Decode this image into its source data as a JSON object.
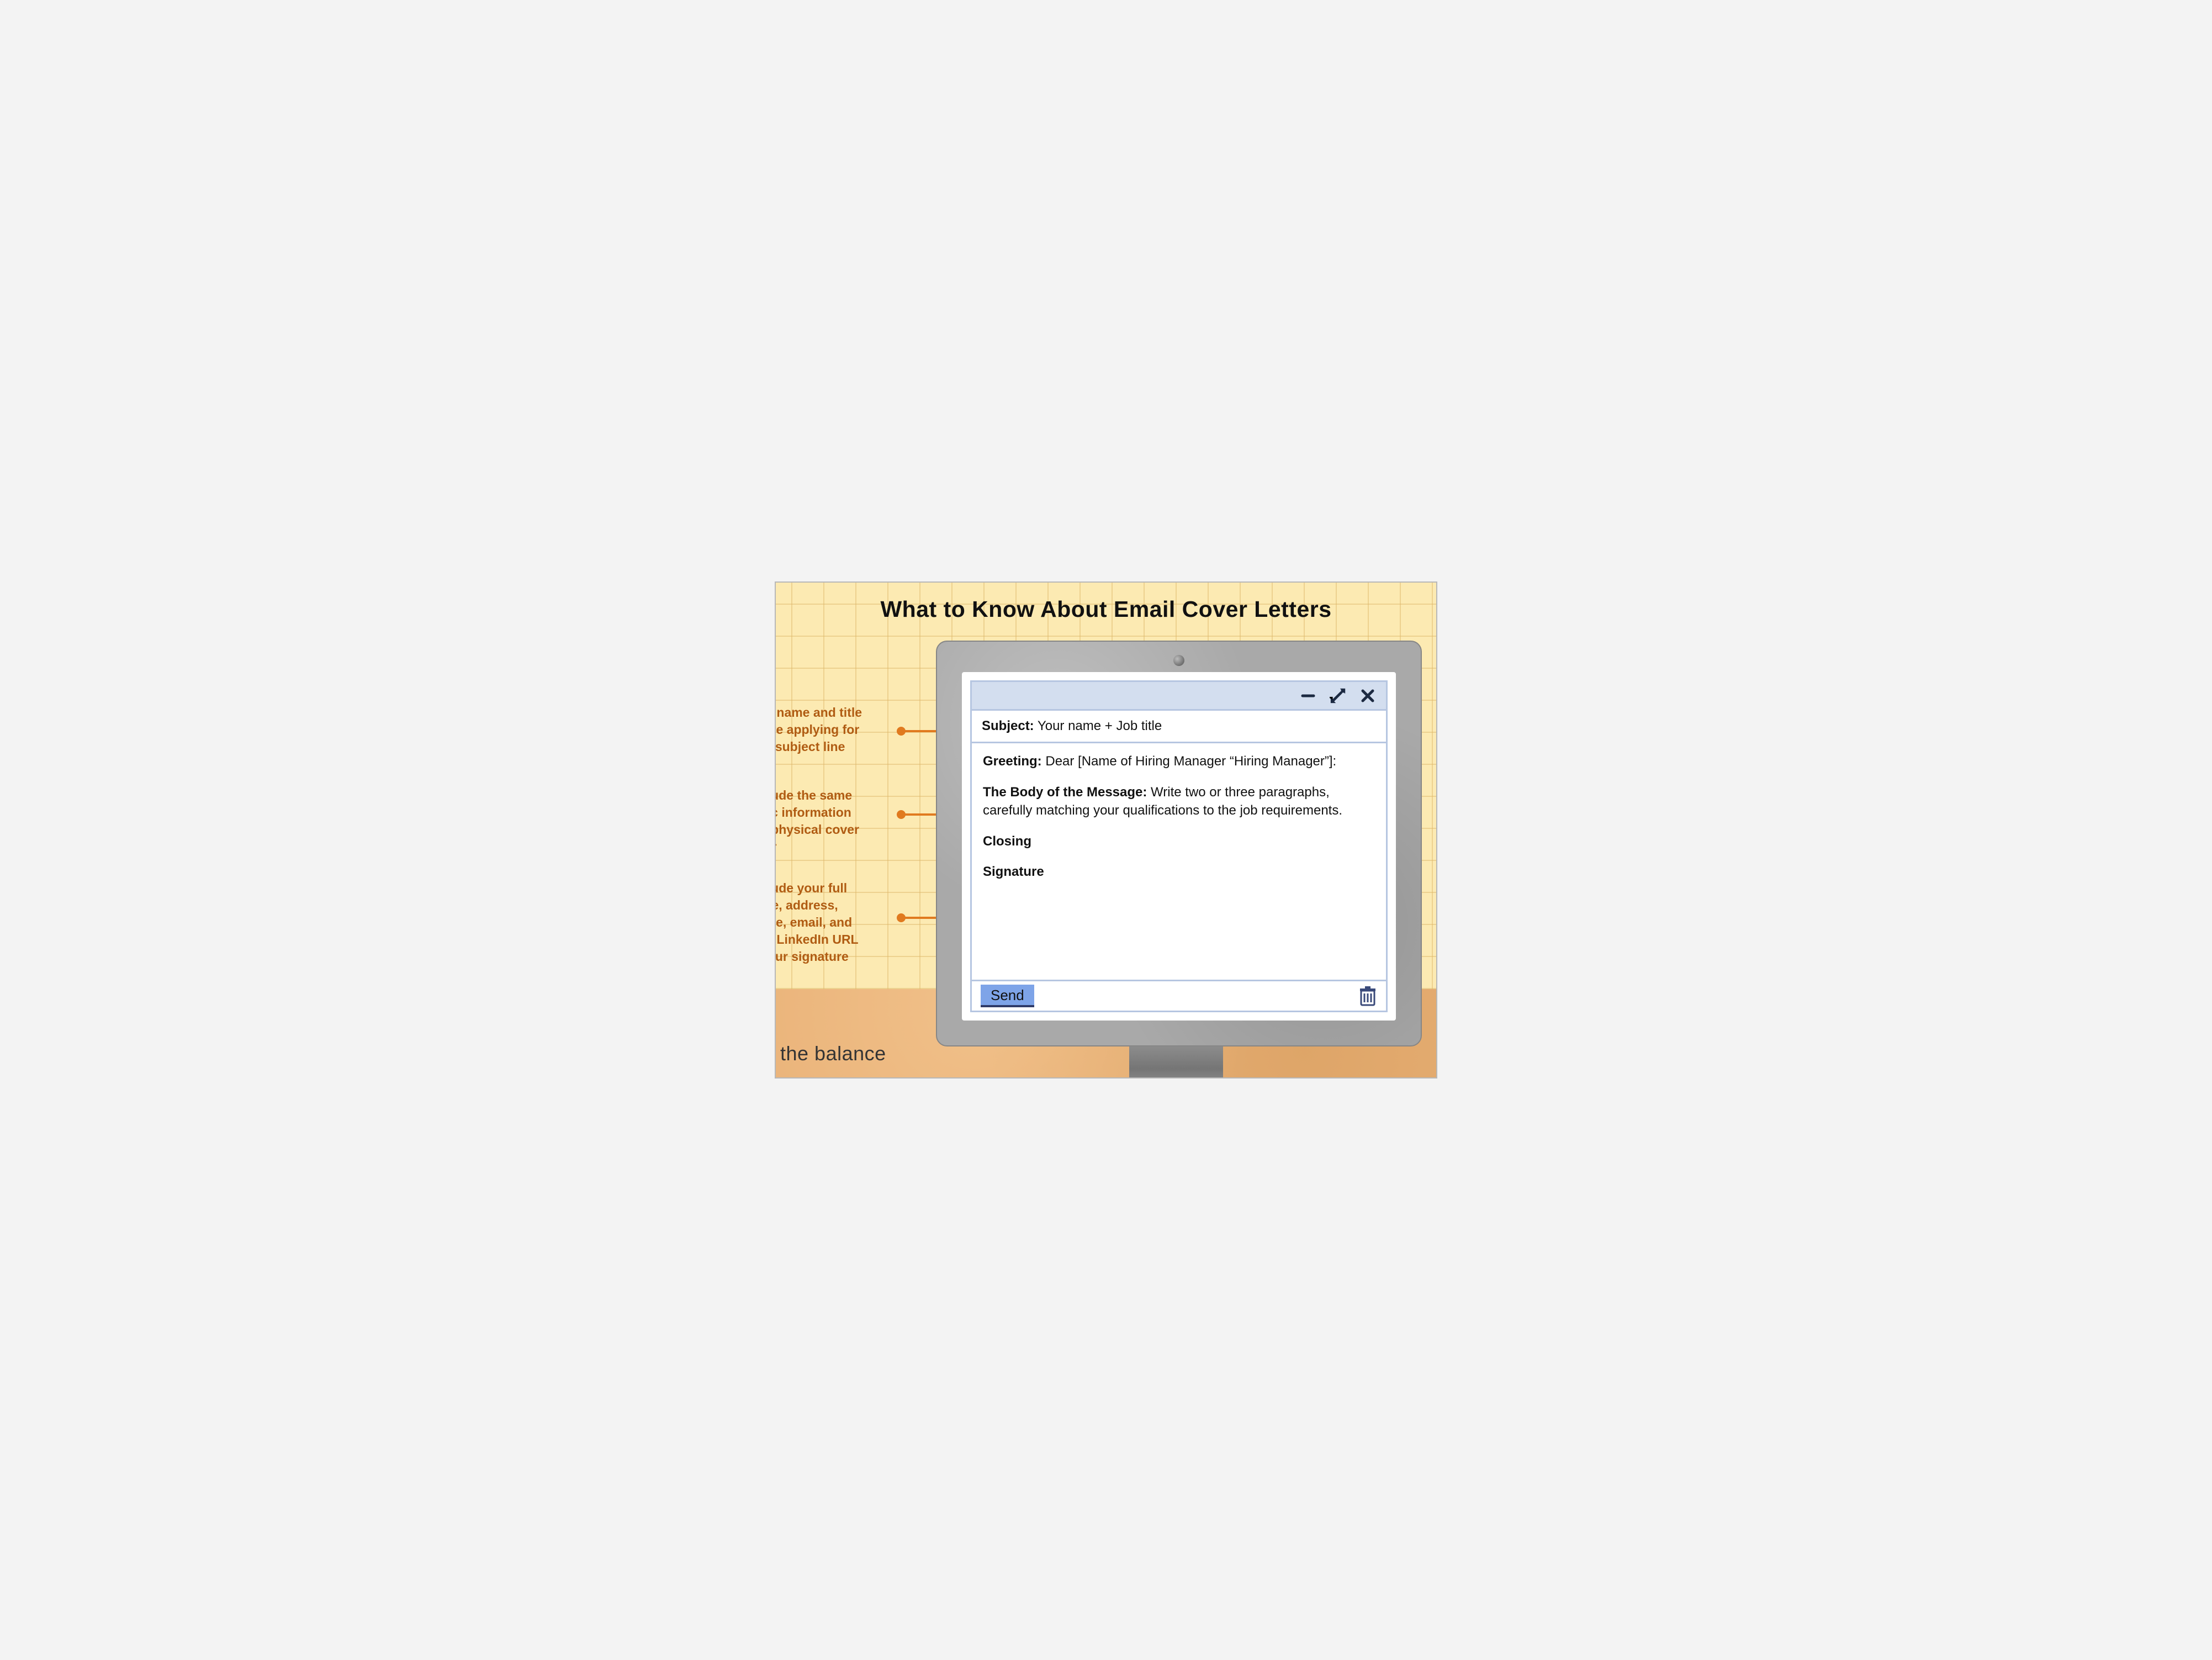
{
  "title": "What to Know About Email Cover Letters",
  "tips": {
    "t1": "ur name and title\nu're applying for\n in subject line",
    "t2": "clude the same\nsic information\n a physical cover\nter",
    "t3": "clude your full\nme, address,\none, email, and\nur LinkedIn URL\nyour signature"
  },
  "email": {
    "subject_label": "Subject:",
    "subject_value": "Your name + Job title",
    "greeting_label": "Greeting:",
    "greeting_value": "Dear [Name of Hiring Manager “Hiring Manager”]:",
    "body_label": "The Body of the Message:",
    "body_value": "Write two or three paragraphs, carefully matching your qualifications to the job requirements.",
    "closing_label": "Closing",
    "signature_label": "Signature",
    "send_label": "Send"
  },
  "brand": "the balance"
}
